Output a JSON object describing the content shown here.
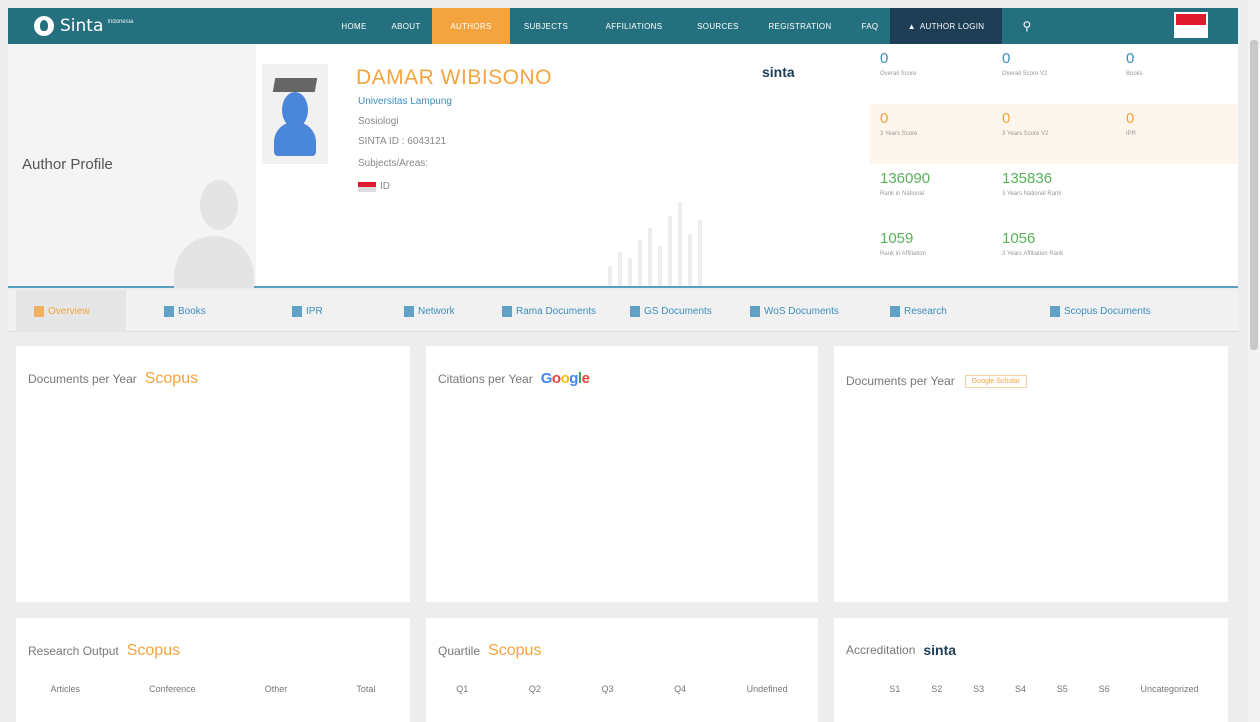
{
  "nav": {
    "brand": "Sinta",
    "brand_sub": "Indonesia",
    "items": [
      {
        "label": "HOME"
      },
      {
        "label": "ABOUT"
      },
      {
        "label": "AUTHORS"
      },
      {
        "label": "SUBJECTS"
      },
      {
        "label": "AFFILIATIONS"
      },
      {
        "label": "SOURCES"
      },
      {
        "label": "REGISTRATION"
      },
      {
        "label": "FAQ"
      },
      {
        "label": "AUTHOR LOGIN"
      }
    ],
    "active_item": "AUTHORS",
    "search_icon": "search-icon",
    "flag_colors": [
      "#e0192e",
      "#ffffff"
    ]
  },
  "profile": {
    "section_title": "Author Profile",
    "name": "DAMAR WIBISONO",
    "affiliation": "Universitas Lampung",
    "field": "Sosiologi",
    "sinta_id": "SINTA ID : 6043121",
    "subjects_label": "Subjects/Areas:",
    "country_code": "ID",
    "logo_text": "sinta"
  },
  "stats": {
    "overall_score": {
      "value": "0",
      "label": "Overall Score"
    },
    "overall_score_v2": {
      "value": "0",
      "label": "Overall Score V2"
    },
    "books": {
      "value": "0",
      "label": "Books"
    },
    "three_years_score": {
      "value": "0",
      "label": "3 Years Score"
    },
    "three_years_score_v2": {
      "value": "0",
      "label": "3 Years Score V2"
    },
    "ipr": {
      "value": "0",
      "label": "IPR"
    },
    "rank_national": {
      "value": "136090",
      "label": "Rank in National"
    },
    "three_years_rank_national": {
      "value": "135836",
      "label": "3 Years National Rank"
    },
    "rank_affiliation": {
      "value": "1059",
      "label": "Rank in Affiliation"
    },
    "three_years_rank_affiliation": {
      "value": "1056",
      "label": "3 Years Affiliation Rank"
    }
  },
  "tabs": [
    {
      "label": "Overview"
    },
    {
      "label": "Books"
    },
    {
      "label": "IPR"
    },
    {
      "label": "Network"
    },
    {
      "label": "Rama Documents"
    },
    {
      "label": "GS Documents"
    },
    {
      "label": "WoS Documents"
    },
    {
      "label": "Research"
    },
    {
      "label": "Scopus Documents"
    }
  ],
  "panels": {
    "docs_scopus": {
      "title": "Documents per Year",
      "source": "Scopus"
    },
    "citations_google": {
      "title": "Citations per Year"
    },
    "docs_gs": {
      "title": "Documents per Year",
      "source": "Google Scholar"
    },
    "research_output": {
      "title": "Research Output",
      "source": "Scopus",
      "columns": [
        "Articles",
        "Conference",
        "Other",
        "Total"
      ]
    },
    "quartile": {
      "title": "Quartile",
      "source": "Scopus",
      "columns": [
        "Q1",
        "Q2",
        "Q3",
        "Q4",
        "Undefined"
      ]
    },
    "accreditation": {
      "title": "Accreditation",
      "logo": "sinta",
      "columns": [
        "S1",
        "S2",
        "S3",
        "S4",
        "S5",
        "S6",
        "Uncategorized"
      ]
    }
  },
  "colors": {
    "nav_bg": "#25707f",
    "accent": "#f3a43f",
    "link": "#3c8dbc",
    "green": "#58b258",
    "login_bg": "#1e3e55"
  }
}
